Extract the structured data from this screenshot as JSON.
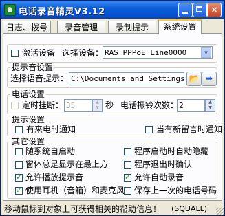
{
  "window": {
    "title": "电话录音精灵V3.12",
    "min_label": "",
    "max_label": "",
    "close_label": "×"
  },
  "tabs": [
    {
      "label": "日志、拨号"
    },
    {
      "label": "录音管理"
    },
    {
      "label": "录制提示"
    },
    {
      "label": "系统设置",
      "active": true
    }
  ],
  "device": {
    "activate_label": "激活设备",
    "activate_checked": false,
    "select_label": "选择设备：",
    "select_value": "RAS PPPoE Line0000"
  },
  "prompt_sound": {
    "legend": "提示音设置",
    "label": "选择语音提示：",
    "path_value": "C:\\Documents and Settings\\Ad"
  },
  "phone": {
    "legend": "电话设置",
    "hangup_label": "定时挂断：",
    "hangup_checked": false,
    "hangup_value": "35",
    "seconds_label": "秒",
    "ring_label": "电话振铃次数：",
    "ring_value": "2"
  },
  "hints": {
    "legend": "提示设置",
    "incoming_label": "有来电时通知",
    "incoming_checked": false,
    "message_label": "当有新留言时通知",
    "message_checked": false
  },
  "other": {
    "legend": "其它设置",
    "items": [
      {
        "label": "随系统自启动",
        "checked": false
      },
      {
        "label": "程序启动时自动隐藏",
        "checked": false
      },
      {
        "label": "窗体总是显示在最上方",
        "checked": false
      },
      {
        "label": "程序退出时确认",
        "checked": false
      },
      {
        "label": "允许播放提示音",
        "checked": true
      },
      {
        "label": "允许自动录音",
        "checked": true
      },
      {
        "label": "使用耳机（音箱）和麦克风",
        "checked": true
      },
      {
        "label": "保存上一次的电话号码",
        "checked": false
      }
    ]
  },
  "status": {
    "text": "移动鼠标到对象上可获得相关的帮助信息！",
    "credit": "(SQUALL)"
  },
  "icons": {
    "open": "folder-open-icon",
    "play": "play-arrow-icon",
    "app": "phone-app-icon"
  }
}
